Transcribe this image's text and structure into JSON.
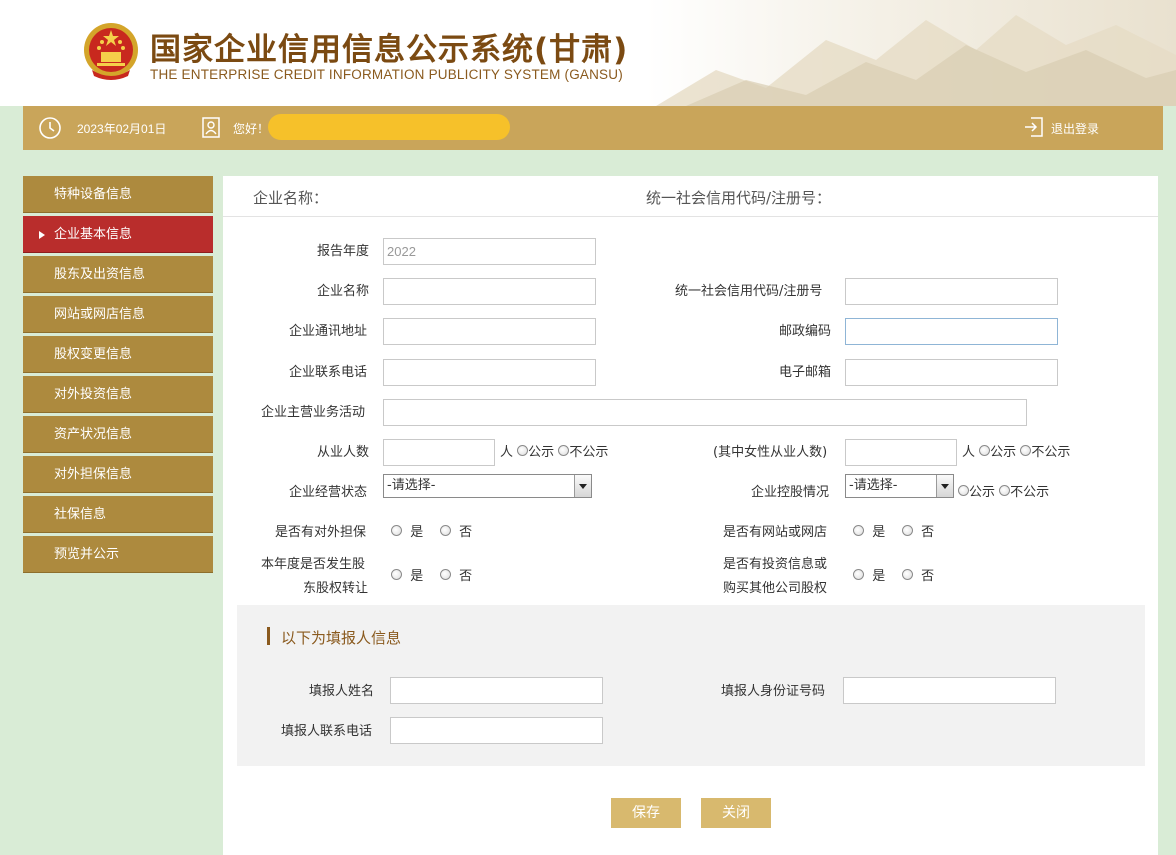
{
  "header": {
    "title_cn": "国家企业信用信息公示系统(甘肃)",
    "title_en": "THE ENTERPRISE CREDIT INFORMATION PUBLICITY SYSTEM (GANSU)"
  },
  "topbar": {
    "date": "2023年02月01日",
    "greeting": "您好！",
    "logout": "退出登录"
  },
  "sidebar": {
    "items": [
      {
        "label": "特种设备信息"
      },
      {
        "label": "企业基本信息",
        "active": true
      },
      {
        "label": "股东及出资信息"
      },
      {
        "label": "网站或网店信息"
      },
      {
        "label": "股权变更信息"
      },
      {
        "label": "对外投资信息"
      },
      {
        "label": "资产状况信息"
      },
      {
        "label": "对外担保信息"
      },
      {
        "label": "社保信息"
      },
      {
        "label": "预览并公示"
      }
    ]
  },
  "main_head": {
    "company_name_label": "企业名称：",
    "credit_code_label": "统一社会信用代码/注册号："
  },
  "form": {
    "year_label": "报告年度",
    "year_value": "2022",
    "name_label": "企业名称",
    "code_label": "统一社会信用代码/注册号",
    "address_label": "企业通讯地址",
    "postcode_label": "邮政编码",
    "phone_label": "企业联系电话",
    "email_label": "电子邮箱",
    "business_label": "企业主营业务活动",
    "employees_label": "从业人数",
    "female_label": "(其中女性从业人数)",
    "person_unit": "人",
    "public": "公示",
    "not_public": "不公示",
    "status_label": "企业经营状态",
    "status_value": "-请选择-",
    "holding_label": "企业控股情况",
    "holding_value": "-请选择-",
    "guarantee_label": "是否有对外担保",
    "website_label": "是否有网站或网店",
    "transfer_label_1": "本年度是否发生股",
    "transfer_label_2": "东股权转让",
    "invest_label_1": "是否有投资信息或",
    "invest_label_2": "购买其他公司股权",
    "yes": "是",
    "no": "否"
  },
  "filler": {
    "section_title": "以下为填报人信息",
    "name_label": "填报人姓名",
    "id_label": "填报人身份证号码",
    "phone_label": "填报人联系电话"
  },
  "actions": {
    "save": "保存",
    "close": "关闭"
  },
  "colors": {
    "brand_gold": "#c9a55a",
    "sidebar_item": "#ad8a3e",
    "sidebar_active": "#b92d2c",
    "button": "#d8b96e",
    "background": "#d9ecd6",
    "redaction": "#f6c12a"
  }
}
